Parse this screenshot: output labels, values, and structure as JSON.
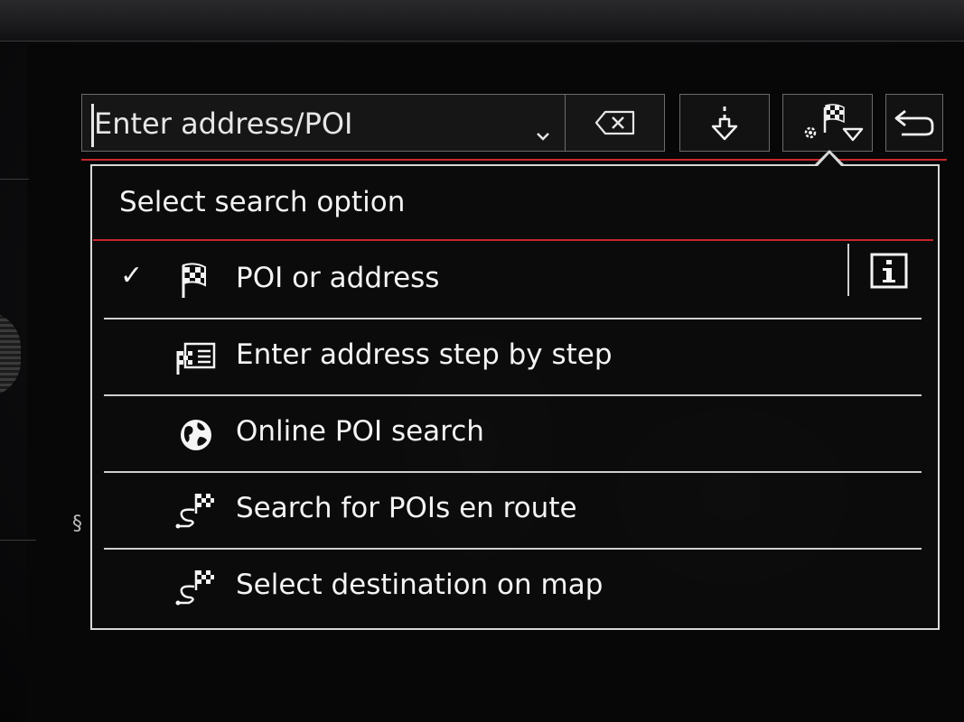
{
  "search": {
    "placeholder": "Enter address/POI",
    "value": ""
  },
  "toolbar": {
    "clear_icon": "backspace-icon",
    "import_icon": "download-arrow-icon",
    "search_options_icon": "settings-flag-dropdown-icon",
    "back_icon": "return-arrow-icon"
  },
  "popup": {
    "title": "Select search option",
    "options": [
      {
        "label": "POI or address",
        "icon": "checkered-flag-icon",
        "selected": true,
        "check_glyph": "✓"
      },
      {
        "label": "Enter address step by step",
        "icon": "address-card-flag-icon",
        "selected": false
      },
      {
        "label": "Online POI search",
        "icon": "globe-icon",
        "selected": false
      },
      {
        "label": "Search for POIs en route",
        "icon": "route-flag-icon",
        "selected": false
      },
      {
        "label": "Select destination on map",
        "icon": "route-flag-icon",
        "selected": false
      }
    ],
    "info_icon": "info-icon"
  },
  "colors": {
    "accent_red": "#c8262a",
    "text": "#f4f4f4",
    "border": "#d8d8d8"
  }
}
